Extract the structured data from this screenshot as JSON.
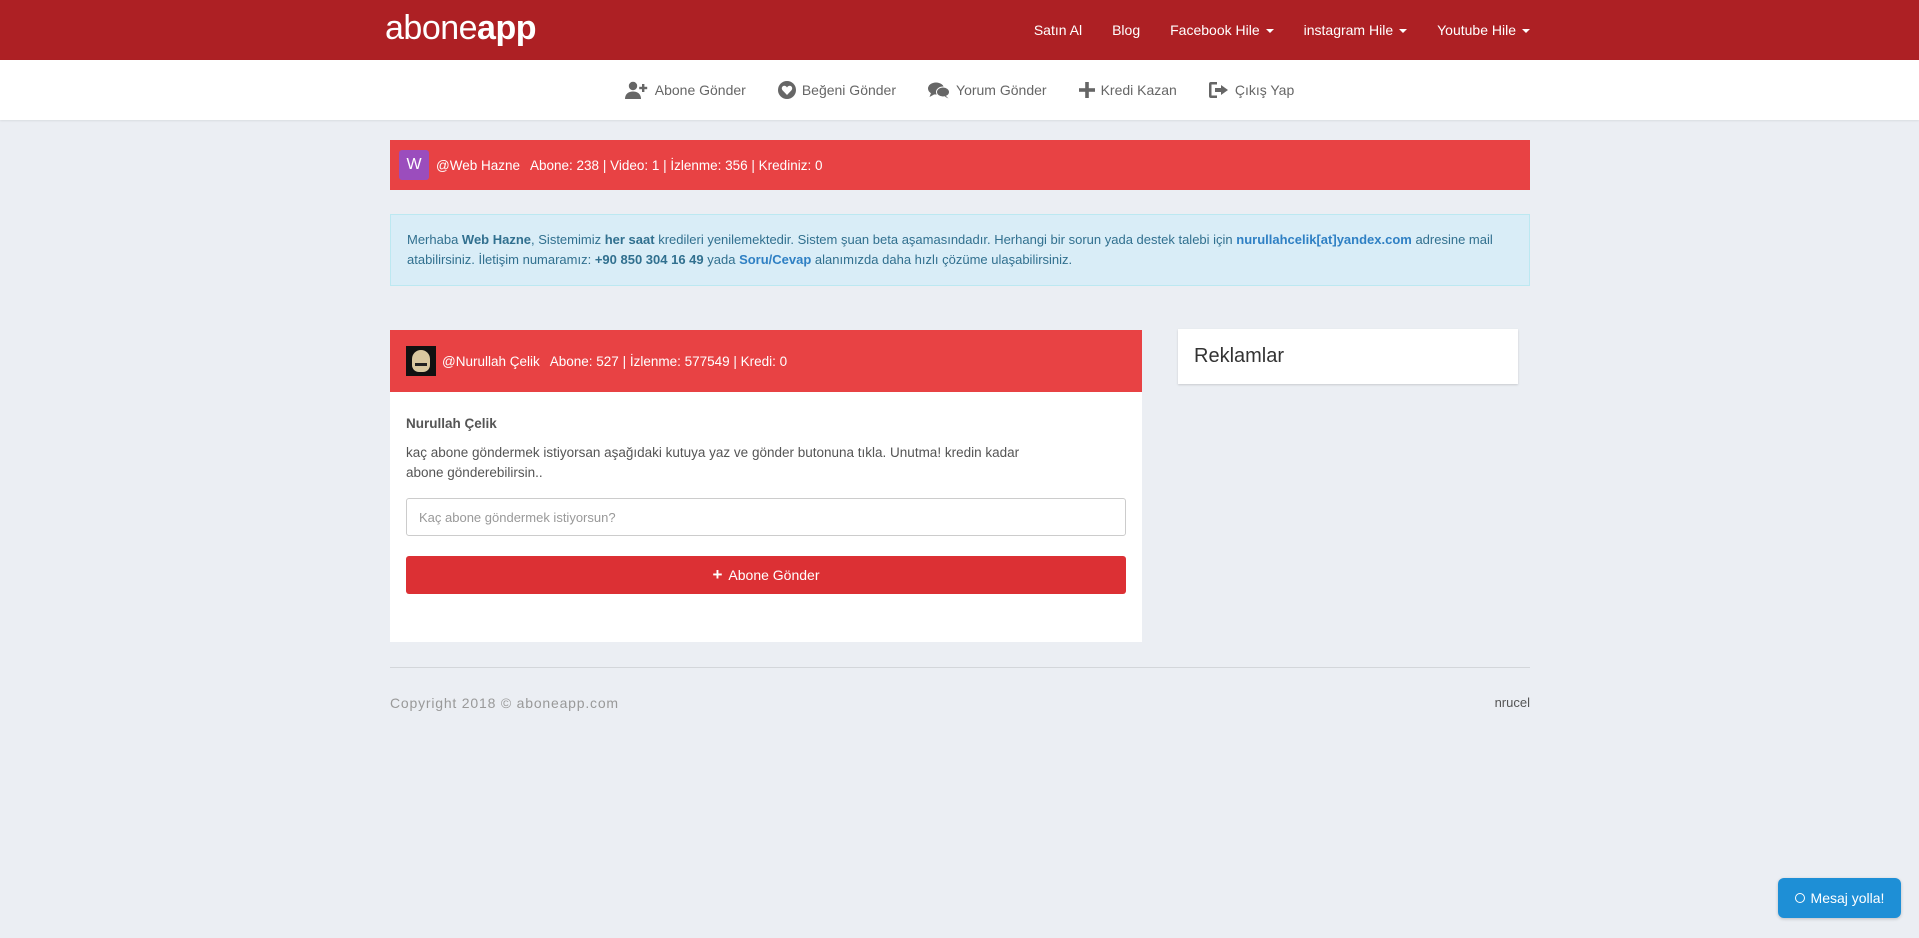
{
  "brand": {
    "part1": "abone",
    "part2": "app"
  },
  "topnav": {
    "items": [
      {
        "label": "Satın Al",
        "dropdown": false
      },
      {
        "label": "Blog",
        "dropdown": false
      },
      {
        "label": "Facebook Hile",
        "dropdown": true
      },
      {
        "label": "instagram Hile",
        "dropdown": true
      },
      {
        "label": "Youtube Hile",
        "dropdown": true
      }
    ]
  },
  "subnav": {
    "abone": "Abone Gönder",
    "begeni": "Beğeni Gönder",
    "yorum": "Yorum Gönder",
    "kredi": "Kredi Kazan",
    "cikis": "Çıkış Yap"
  },
  "userbar": {
    "avatar_letter": "W",
    "handle": "@Web Hazne",
    "stats": "Abone: 238  | Video: 1 | İzlenme: 356 | Krediniz: 0"
  },
  "alert": {
    "t1": "Merhaba ",
    "name": "Web Hazne",
    "t2": ", Sistemimiz ",
    "freq": "her saat",
    "t3": " kredileri yenilemektedir. Sistem şuan beta aşamasındadır. Herhangi bir sorun yada destek talebi için ",
    "email": "nurullahcelik[at]yandex.com",
    "t4": " adresine mail atabilirsiniz. İletişim numaramız: ",
    "phone": "+90 850 304 16 49",
    "t5": " yada ",
    "faq": "Soru/Cevap",
    "t6": " alanımızda daha hızlı çözüme ulaşabilirsiniz."
  },
  "panel": {
    "handle": "@Nurullah Çelik",
    "stats": "Abone: 527  | İzlenme: 577549 | Kredi: 0",
    "name": "Nurullah Çelik",
    "desc": "kaç abone göndermek istiyorsan aşağıdaki kutuya yaz ve gönder butonuna tıkla. Unutma! kredin kadar abone gönderebilirsin..",
    "input_placeholder": "Kaç abone göndermek istiyorsun?",
    "button_label": "Abone Gönder"
  },
  "sidebar": {
    "title": "Reklamlar"
  },
  "footer": {
    "copyright": "Copyright 2018 © aboneapp.com",
    "right": "nrucel"
  },
  "chat": {
    "label": "Mesaj yolla!"
  }
}
